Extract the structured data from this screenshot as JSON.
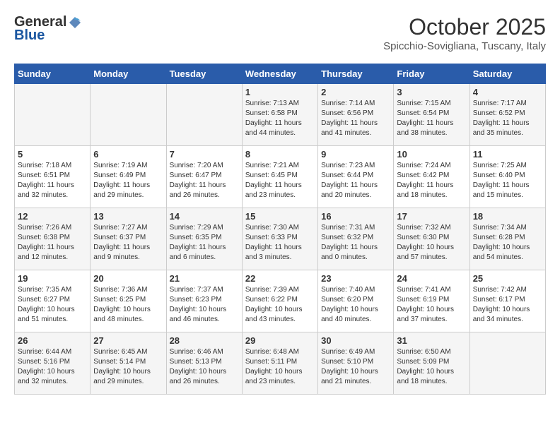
{
  "logo": {
    "general": "General",
    "blue": "Blue"
  },
  "header": {
    "month": "October 2025",
    "location": "Spicchio-Sovigliana, Tuscany, Italy"
  },
  "days_of_week": [
    "Sunday",
    "Monday",
    "Tuesday",
    "Wednesday",
    "Thursday",
    "Friday",
    "Saturday"
  ],
  "weeks": [
    [
      {
        "day": "",
        "info": ""
      },
      {
        "day": "",
        "info": ""
      },
      {
        "day": "",
        "info": ""
      },
      {
        "day": "1",
        "info": "Sunrise: 7:13 AM\nSunset: 6:58 PM\nDaylight: 11 hours and 44 minutes."
      },
      {
        "day": "2",
        "info": "Sunrise: 7:14 AM\nSunset: 6:56 PM\nDaylight: 11 hours and 41 minutes."
      },
      {
        "day": "3",
        "info": "Sunrise: 7:15 AM\nSunset: 6:54 PM\nDaylight: 11 hours and 38 minutes."
      },
      {
        "day": "4",
        "info": "Sunrise: 7:17 AM\nSunset: 6:52 PM\nDaylight: 11 hours and 35 minutes."
      }
    ],
    [
      {
        "day": "5",
        "info": "Sunrise: 7:18 AM\nSunset: 6:51 PM\nDaylight: 11 hours and 32 minutes."
      },
      {
        "day": "6",
        "info": "Sunrise: 7:19 AM\nSunset: 6:49 PM\nDaylight: 11 hours and 29 minutes."
      },
      {
        "day": "7",
        "info": "Sunrise: 7:20 AM\nSunset: 6:47 PM\nDaylight: 11 hours and 26 minutes."
      },
      {
        "day": "8",
        "info": "Sunrise: 7:21 AM\nSunset: 6:45 PM\nDaylight: 11 hours and 23 minutes."
      },
      {
        "day": "9",
        "info": "Sunrise: 7:23 AM\nSunset: 6:44 PM\nDaylight: 11 hours and 20 minutes."
      },
      {
        "day": "10",
        "info": "Sunrise: 7:24 AM\nSunset: 6:42 PM\nDaylight: 11 hours and 18 minutes."
      },
      {
        "day": "11",
        "info": "Sunrise: 7:25 AM\nSunset: 6:40 PM\nDaylight: 11 hours and 15 minutes."
      }
    ],
    [
      {
        "day": "12",
        "info": "Sunrise: 7:26 AM\nSunset: 6:38 PM\nDaylight: 11 hours and 12 minutes."
      },
      {
        "day": "13",
        "info": "Sunrise: 7:27 AM\nSunset: 6:37 PM\nDaylight: 11 hours and 9 minutes."
      },
      {
        "day": "14",
        "info": "Sunrise: 7:29 AM\nSunset: 6:35 PM\nDaylight: 11 hours and 6 minutes."
      },
      {
        "day": "15",
        "info": "Sunrise: 7:30 AM\nSunset: 6:33 PM\nDaylight: 11 hours and 3 minutes."
      },
      {
        "day": "16",
        "info": "Sunrise: 7:31 AM\nSunset: 6:32 PM\nDaylight: 11 hours and 0 minutes."
      },
      {
        "day": "17",
        "info": "Sunrise: 7:32 AM\nSunset: 6:30 PM\nDaylight: 10 hours and 57 minutes."
      },
      {
        "day": "18",
        "info": "Sunrise: 7:34 AM\nSunset: 6:28 PM\nDaylight: 10 hours and 54 minutes."
      }
    ],
    [
      {
        "day": "19",
        "info": "Sunrise: 7:35 AM\nSunset: 6:27 PM\nDaylight: 10 hours and 51 minutes."
      },
      {
        "day": "20",
        "info": "Sunrise: 7:36 AM\nSunset: 6:25 PM\nDaylight: 10 hours and 48 minutes."
      },
      {
        "day": "21",
        "info": "Sunrise: 7:37 AM\nSunset: 6:23 PM\nDaylight: 10 hours and 46 minutes."
      },
      {
        "day": "22",
        "info": "Sunrise: 7:39 AM\nSunset: 6:22 PM\nDaylight: 10 hours and 43 minutes."
      },
      {
        "day": "23",
        "info": "Sunrise: 7:40 AM\nSunset: 6:20 PM\nDaylight: 10 hours and 40 minutes."
      },
      {
        "day": "24",
        "info": "Sunrise: 7:41 AM\nSunset: 6:19 PM\nDaylight: 10 hours and 37 minutes."
      },
      {
        "day": "25",
        "info": "Sunrise: 7:42 AM\nSunset: 6:17 PM\nDaylight: 10 hours and 34 minutes."
      }
    ],
    [
      {
        "day": "26",
        "info": "Sunrise: 6:44 AM\nSunset: 5:16 PM\nDaylight: 10 hours and 32 minutes."
      },
      {
        "day": "27",
        "info": "Sunrise: 6:45 AM\nSunset: 5:14 PM\nDaylight: 10 hours and 29 minutes."
      },
      {
        "day": "28",
        "info": "Sunrise: 6:46 AM\nSunset: 5:13 PM\nDaylight: 10 hours and 26 minutes."
      },
      {
        "day": "29",
        "info": "Sunrise: 6:48 AM\nSunset: 5:11 PM\nDaylight: 10 hours and 23 minutes."
      },
      {
        "day": "30",
        "info": "Sunrise: 6:49 AM\nSunset: 5:10 PM\nDaylight: 10 hours and 21 minutes."
      },
      {
        "day": "31",
        "info": "Sunrise: 6:50 AM\nSunset: 5:09 PM\nDaylight: 10 hours and 18 minutes."
      },
      {
        "day": "",
        "info": ""
      }
    ]
  ]
}
